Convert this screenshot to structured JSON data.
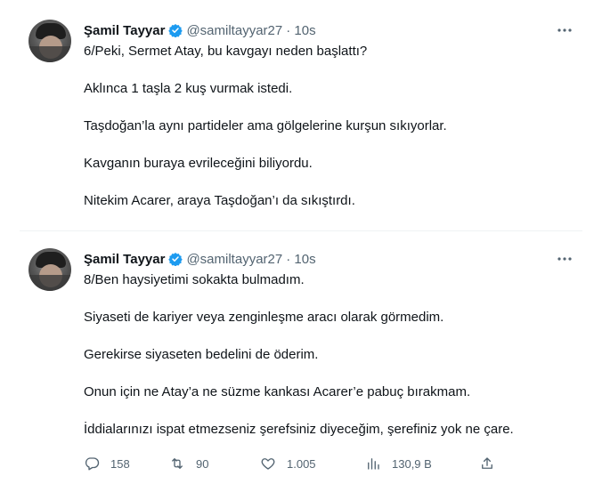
{
  "tweets": [
    {
      "name": "Şamil Tayyar",
      "handle": "@samiltayyar27",
      "time": "· 10s",
      "lines": [
        "6/Peki, Sermet Atay, bu kavgayı neden başlattı?",
        "Aklınca 1 taşla 2 kuş vurmak istedi.",
        "Taşdoğan’la aynı partideler ama gölgelerine kurşun sıkıyorlar.",
        "Kavganın buraya evrileceğini biliyordu.",
        "Nitekim Acarer, araya Taşdoğan’ı da sıkıştırdı."
      ]
    },
    {
      "name": "Şamil Tayyar",
      "handle": "@samiltayyar27",
      "time": "· 10s",
      "lines": [
        "8/Ben haysiyetimi sokakta bulmadım.",
        "Siyaseti de kariyer veya zenginleşme aracı olarak görmedim.",
        "Gerekirse siyaseten bedelini de öderim.",
        "Onun için ne Atay’a ne süzme kankası Acarer’e pabuç bırakmam.",
        "İddialarınızı ispat etmezseniz şerefsiniz diyeceğim, şerefiniz yok ne çare."
      ],
      "stats": {
        "replies": "158",
        "retweets": "90",
        "likes": "1.005",
        "views": "130,9 B"
      }
    }
  ],
  "icons": [
    "verified-badge-icon",
    "more-icon",
    "reply-icon",
    "retweet-icon",
    "like-icon",
    "views-icon",
    "share-icon"
  ],
  "colors": {
    "verified": "#1d9bf0",
    "text": "#0f1419",
    "secondary": "#536471"
  }
}
